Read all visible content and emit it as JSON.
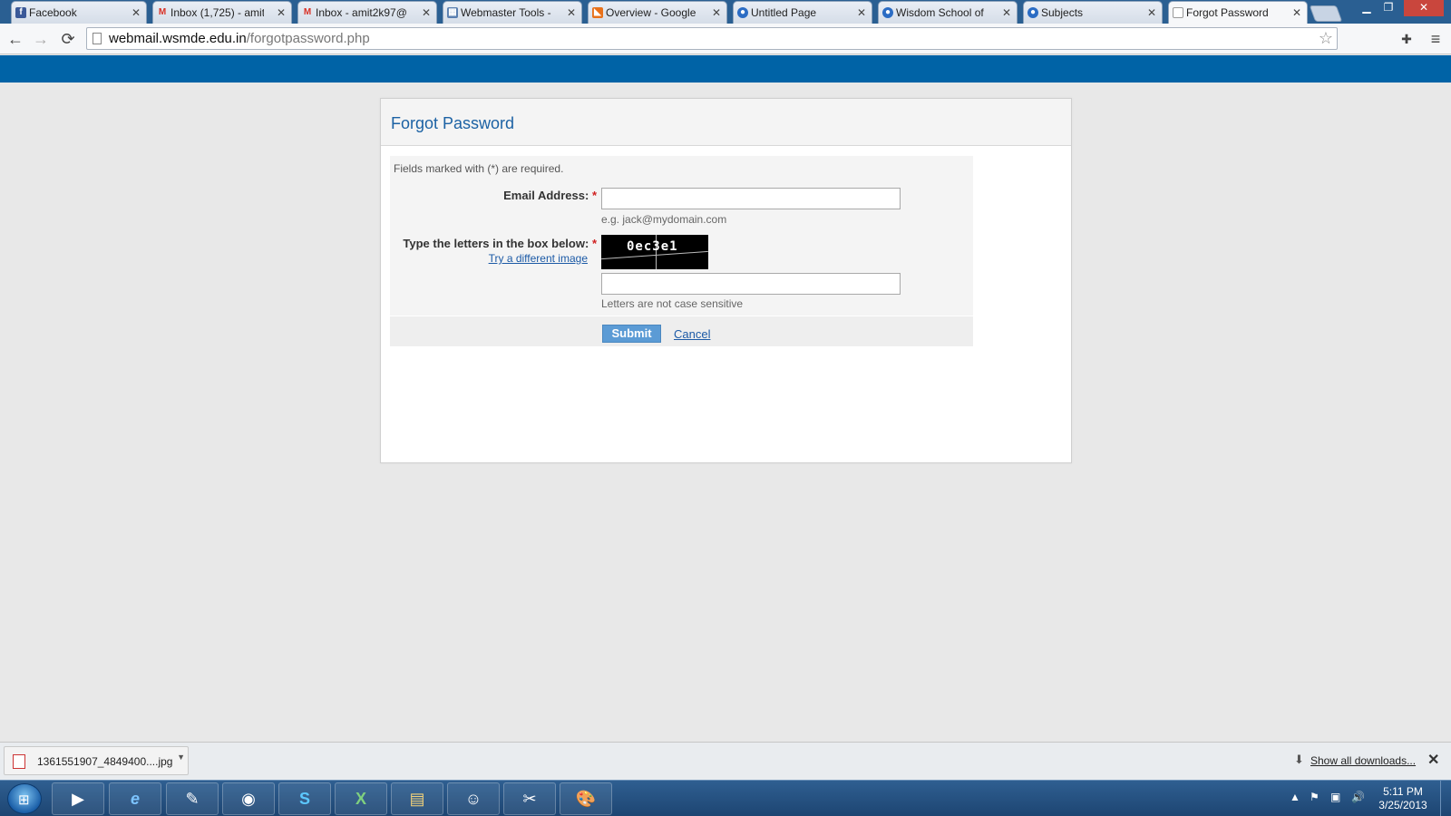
{
  "browser": {
    "tabs": [
      {
        "label": "Facebook",
        "icon": "facebook-icon",
        "icon_glyph": "f",
        "icon_color": "#3b5998"
      },
      {
        "label": "Inbox (1,725) - amit",
        "icon": "gmail-icon",
        "icon_glyph": "M",
        "icon_color": "#d93025"
      },
      {
        "label": "Inbox - amit2k97@",
        "icon": "gmail-icon",
        "icon_glyph": "M",
        "icon_color": "#d93025"
      },
      {
        "label": "Webmaster Tools -",
        "icon": "webmaster-icon",
        "icon_glyph": "▦",
        "icon_color": "#5a7fb0"
      },
      {
        "label": "Overview - Google",
        "icon": "analytics-icon",
        "icon_glyph": "◣",
        "icon_color": "#e8711a"
      },
      {
        "label": "Untitled Page",
        "icon": "globe-icon",
        "icon_glyph": "●",
        "icon_color": "#2b6cc4"
      },
      {
        "label": "Wisdom School of",
        "icon": "globe-icon",
        "icon_glyph": "●",
        "icon_color": "#2b6cc4"
      },
      {
        "label": "Subjects",
        "icon": "globe-icon",
        "icon_glyph": "●",
        "icon_color": "#2b6cc4"
      },
      {
        "label": "Forgot Password",
        "icon": "page-icon",
        "icon_glyph": "▯",
        "icon_color": "#999999"
      }
    ],
    "active_tab": 8,
    "url_host": "webmail.wsmde.edu.in",
    "url_path": "/forgotpassword.php"
  },
  "page": {
    "title": "Forgot Password",
    "required_note": "Fields marked with (*) are required.",
    "email_label": "Email Address:",
    "required_mark": "*",
    "email_value": "",
    "email_hint": "e.g. jack@mydomain.com",
    "captcha_label": "Type the letters in the box below:",
    "captcha_link": "Try a different image",
    "captcha_text": "0ec3e1",
    "captcha_value": "",
    "captcha_hint": "Letters are not case sensitive",
    "submit_label": "Submit",
    "cancel_label": "Cancel",
    "accent_color": "#0063a6"
  },
  "downloads": {
    "file": "1361551907_4849400....jpg",
    "show_all": "Show all downloads..."
  },
  "taskbar": {
    "apps": [
      "media-player-icon",
      "internet-explorer-icon",
      "sticky-app-icon",
      "chrome-icon",
      "skype-icon",
      "excel-icon",
      "file-explorer-icon",
      "people-app-icon",
      "snipping-tool-icon",
      "paint-icon"
    ],
    "time": "5:11 PM",
    "date": "3/25/2013"
  }
}
